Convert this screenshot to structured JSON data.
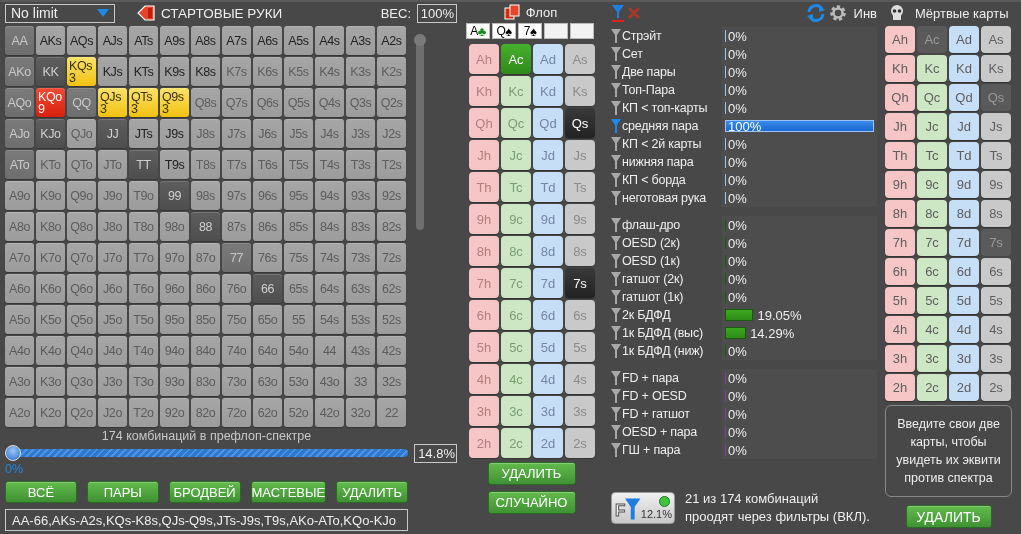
{
  "left_panel": {
    "game_select": {
      "value": "No limit"
    },
    "title": "СТАРТОВЫЕ РУКИ",
    "weight": {
      "label": "ВЕС:",
      "value": "100%"
    },
    "hand_grid": [
      [
        {
          "label": "AA",
          "kind": "blocked"
        },
        {
          "label": "AKs",
          "kind": "selected"
        },
        {
          "label": "AQs",
          "kind": "selected"
        },
        {
          "label": "AJs",
          "kind": "selected"
        },
        {
          "label": "ATs",
          "kind": "selected"
        },
        {
          "label": "A9s",
          "kind": "selected"
        },
        {
          "label": "A8s",
          "kind": "selected"
        },
        {
          "label": "A7s",
          "kind": "selected"
        },
        {
          "label": "A6s",
          "kind": "selected"
        },
        {
          "label": "A5s",
          "kind": "selected"
        },
        {
          "label": "A4s",
          "kind": "selected"
        },
        {
          "label": "A3s",
          "kind": "selected"
        },
        {
          "label": "A2s",
          "kind": "selected"
        }
      ],
      [
        {
          "label": "AKo",
          "kind": "blocked"
        },
        {
          "label": "KK",
          "kind": "dark"
        },
        {
          "label": "KQs",
          "kind": "hit",
          "count": "3"
        },
        {
          "label": "KJs",
          "kind": "selected"
        },
        {
          "label": "KTs",
          "kind": "selected"
        },
        {
          "label": "K9s",
          "kind": "selected"
        },
        {
          "label": "K8s",
          "kind": "selected"
        },
        {
          "label": "K7s",
          "kind": "off"
        },
        {
          "label": "K6s",
          "kind": "off"
        },
        {
          "label": "K5s",
          "kind": "off"
        },
        {
          "label": "K4s",
          "kind": "off"
        },
        {
          "label": "K3s",
          "kind": "off"
        },
        {
          "label": "K2s",
          "kind": "off"
        }
      ],
      [
        {
          "label": "AQo",
          "kind": "blocked"
        },
        {
          "label": "KQo",
          "kind": "hitmax",
          "count": "9"
        },
        {
          "label": "QQ",
          "kind": "blocked"
        },
        {
          "label": "QJs",
          "kind": "hit",
          "count": "3"
        },
        {
          "label": "QTs",
          "kind": "hit",
          "count": "3"
        },
        {
          "label": "Q9s",
          "kind": "hit",
          "count": "3"
        },
        {
          "label": "Q8s",
          "kind": "off"
        },
        {
          "label": "Q7s",
          "kind": "off"
        },
        {
          "label": "Q6s",
          "kind": "off"
        },
        {
          "label": "Q5s",
          "kind": "off"
        },
        {
          "label": "Q4s",
          "kind": "off"
        },
        {
          "label": "Q3s",
          "kind": "off"
        },
        {
          "label": "Q2s",
          "kind": "off"
        }
      ],
      [
        {
          "label": "AJo",
          "kind": "blocked"
        },
        {
          "label": "KJo",
          "kind": "dark"
        },
        {
          "label": "QJo",
          "kind": "off"
        },
        {
          "label": "JJ",
          "kind": "dark"
        },
        {
          "label": "JTs",
          "kind": "selected"
        },
        {
          "label": "J9s",
          "kind": "selected"
        },
        {
          "label": "J8s",
          "kind": "off"
        },
        {
          "label": "J7s",
          "kind": "off"
        },
        {
          "label": "J6s",
          "kind": "off"
        },
        {
          "label": "J5s",
          "kind": "off"
        },
        {
          "label": "J4s",
          "kind": "off"
        },
        {
          "label": "J3s",
          "kind": "off"
        },
        {
          "label": "J2s",
          "kind": "off"
        }
      ],
      [
        {
          "label": "ATo",
          "kind": "blocked"
        },
        {
          "label": "KTo",
          "kind": "off"
        },
        {
          "label": "QTo",
          "kind": "off"
        },
        {
          "label": "JTo",
          "kind": "off"
        },
        {
          "label": "TT",
          "kind": "dark"
        },
        {
          "label": "T9s",
          "kind": "selected"
        },
        {
          "label": "T8s",
          "kind": "off"
        },
        {
          "label": "T7s",
          "kind": "off"
        },
        {
          "label": "T6s",
          "kind": "off"
        },
        {
          "label": "T5s",
          "kind": "off"
        },
        {
          "label": "T4s",
          "kind": "off"
        },
        {
          "label": "T3s",
          "kind": "off"
        },
        {
          "label": "T2s",
          "kind": "off"
        }
      ],
      [
        {
          "label": "A9o",
          "kind": "off"
        },
        {
          "label": "K9o",
          "kind": "off"
        },
        {
          "label": "Q9o",
          "kind": "off"
        },
        {
          "label": "J9o",
          "kind": "off"
        },
        {
          "label": "T9o",
          "kind": "off"
        },
        {
          "label": "99",
          "kind": "dark"
        },
        {
          "label": "98s",
          "kind": "off"
        },
        {
          "label": "97s",
          "kind": "off"
        },
        {
          "label": "96s",
          "kind": "off"
        },
        {
          "label": "95s",
          "kind": "off"
        },
        {
          "label": "94s",
          "kind": "off"
        },
        {
          "label": "93s",
          "kind": "off"
        },
        {
          "label": "92s",
          "kind": "off"
        }
      ],
      [
        {
          "label": "A8o",
          "kind": "off"
        },
        {
          "label": "K8o",
          "kind": "off"
        },
        {
          "label": "Q8o",
          "kind": "off"
        },
        {
          "label": "J8o",
          "kind": "off"
        },
        {
          "label": "T8o",
          "kind": "off"
        },
        {
          "label": "98o",
          "kind": "off"
        },
        {
          "label": "88",
          "kind": "dark"
        },
        {
          "label": "87s",
          "kind": "off"
        },
        {
          "label": "86s",
          "kind": "off"
        },
        {
          "label": "85s",
          "kind": "off"
        },
        {
          "label": "84s",
          "kind": "off"
        },
        {
          "label": "83s",
          "kind": "off"
        },
        {
          "label": "82s",
          "kind": "off"
        }
      ],
      [
        {
          "label": "A7o",
          "kind": "off"
        },
        {
          "label": "K7o",
          "kind": "off"
        },
        {
          "label": "Q7o",
          "kind": "off"
        },
        {
          "label": "J7o",
          "kind": "off"
        },
        {
          "label": "T7o",
          "kind": "off"
        },
        {
          "label": "97o",
          "kind": "off"
        },
        {
          "label": "87o",
          "kind": "off"
        },
        {
          "label": "77",
          "kind": "blocked"
        },
        {
          "label": "76s",
          "kind": "off"
        },
        {
          "label": "75s",
          "kind": "off"
        },
        {
          "label": "74s",
          "kind": "off"
        },
        {
          "label": "73s",
          "kind": "off"
        },
        {
          "label": "72s",
          "kind": "off"
        }
      ],
      [
        {
          "label": "A6o",
          "kind": "off"
        },
        {
          "label": "K6o",
          "kind": "off"
        },
        {
          "label": "Q6o",
          "kind": "off"
        },
        {
          "label": "J6o",
          "kind": "off"
        },
        {
          "label": "T6o",
          "kind": "off"
        },
        {
          "label": "96o",
          "kind": "off"
        },
        {
          "label": "86o",
          "kind": "off"
        },
        {
          "label": "76o",
          "kind": "off"
        },
        {
          "label": "66",
          "kind": "dark"
        },
        {
          "label": "65s",
          "kind": "off"
        },
        {
          "label": "64s",
          "kind": "off"
        },
        {
          "label": "63s",
          "kind": "off"
        },
        {
          "label": "62s",
          "kind": "off"
        }
      ],
      [
        {
          "label": "A5o",
          "kind": "off"
        },
        {
          "label": "K5o",
          "kind": "off"
        },
        {
          "label": "Q5o",
          "kind": "off"
        },
        {
          "label": "J5o",
          "kind": "off"
        },
        {
          "label": "T5o",
          "kind": "off"
        },
        {
          "label": "95o",
          "kind": "off"
        },
        {
          "label": "85o",
          "kind": "off"
        },
        {
          "label": "75o",
          "kind": "off"
        },
        {
          "label": "65o",
          "kind": "off"
        },
        {
          "label": "55",
          "kind": "off"
        },
        {
          "label": "54s",
          "kind": "off"
        },
        {
          "label": "53s",
          "kind": "off"
        },
        {
          "label": "52s",
          "kind": "off"
        }
      ],
      [
        {
          "label": "A4o",
          "kind": "off"
        },
        {
          "label": "K4o",
          "kind": "off"
        },
        {
          "label": "Q4o",
          "kind": "off"
        },
        {
          "label": "J4o",
          "kind": "off"
        },
        {
          "label": "T4o",
          "kind": "off"
        },
        {
          "label": "94o",
          "kind": "off"
        },
        {
          "label": "84o",
          "kind": "off"
        },
        {
          "label": "74o",
          "kind": "off"
        },
        {
          "label": "64o",
          "kind": "off"
        },
        {
          "label": "54o",
          "kind": "off"
        },
        {
          "label": "44",
          "kind": "off"
        },
        {
          "label": "43s",
          "kind": "off"
        },
        {
          "label": "42s",
          "kind": "off"
        }
      ],
      [
        {
          "label": "A3o",
          "kind": "off"
        },
        {
          "label": "K3o",
          "kind": "off"
        },
        {
          "label": "Q3o",
          "kind": "off"
        },
        {
          "label": "J3o",
          "kind": "off"
        },
        {
          "label": "T3o",
          "kind": "off"
        },
        {
          "label": "93o",
          "kind": "off"
        },
        {
          "label": "83o",
          "kind": "off"
        },
        {
          "label": "73o",
          "kind": "off"
        },
        {
          "label": "63o",
          "kind": "off"
        },
        {
          "label": "53o",
          "kind": "off"
        },
        {
          "label": "43o",
          "kind": "off"
        },
        {
          "label": "33",
          "kind": "off"
        },
        {
          "label": "32s",
          "kind": "off"
        }
      ],
      [
        {
          "label": "A2o",
          "kind": "off"
        },
        {
          "label": "K2o",
          "kind": "off"
        },
        {
          "label": "Q2o",
          "kind": "off"
        },
        {
          "label": "J2o",
          "kind": "off"
        },
        {
          "label": "T2o",
          "kind": "off"
        },
        {
          "label": "92o",
          "kind": "off"
        },
        {
          "label": "82o",
          "kind": "off"
        },
        {
          "label": "72o",
          "kind": "off"
        },
        {
          "label": "62o",
          "kind": "off"
        },
        {
          "label": "52o",
          "kind": "off"
        },
        {
          "label": "42o",
          "kind": "off"
        },
        {
          "label": "32o",
          "kind": "off"
        },
        {
          "label": "22",
          "kind": "off"
        }
      ]
    ],
    "combo_count": "174 комбинаций в префлоп-спектре",
    "range_slider": {
      "level": 0,
      "min_label": "0%",
      "value": "14.8%"
    },
    "buttons": [
      "ВСЁ",
      "ПАРЫ",
      "БРОДВЕЙ",
      "МАСТЕВЫЕ",
      "УДАЛИТЬ"
    ],
    "range_text": "AA-66,AKs-A2s,KQs-K8s,QJs-Q9s,JTs-J9s,T9s,AKo-ATo,KQo-KJo"
  },
  "flop": {
    "title": "Флоп",
    "board": [
      {
        "kind": "card",
        "rank": "A",
        "suit": "♣",
        "color": "#178a17"
      },
      {
        "kind": "card",
        "rank": "Q",
        "suit": "♠",
        "color": "#000000"
      },
      {
        "kind": "card",
        "rank": "7",
        "suit": "♠",
        "color": "#000000"
      },
      {
        "kind": "empty"
      },
      {
        "kind": "empty"
      }
    ],
    "cards": [
      [
        {
          "label": "Ah",
          "kind": "free"
        },
        {
          "label": "Ac",
          "kind": "picked"
        },
        {
          "label": "Ad",
          "kind": "free"
        },
        {
          "label": "As",
          "kind": "free"
        }
      ],
      [
        {
          "label": "Kh",
          "kind": "free"
        },
        {
          "label": "Kc",
          "kind": "free"
        },
        {
          "label": "Kd",
          "kind": "free"
        },
        {
          "label": "Ks",
          "kind": "free"
        }
      ],
      [
        {
          "label": "Qh",
          "kind": "free"
        },
        {
          "label": "Qc",
          "kind": "free"
        },
        {
          "label": "Qd",
          "kind": "free"
        },
        {
          "label": "Qs",
          "kind": "picked"
        }
      ],
      [
        {
          "label": "Jh",
          "kind": "free"
        },
        {
          "label": "Jc",
          "kind": "free"
        },
        {
          "label": "Jd",
          "kind": "free"
        },
        {
          "label": "Js",
          "kind": "free"
        }
      ],
      [
        {
          "label": "Th",
          "kind": "free"
        },
        {
          "label": "Tc",
          "kind": "free"
        },
        {
          "label": "Td",
          "kind": "free"
        },
        {
          "label": "Ts",
          "kind": "free"
        }
      ],
      [
        {
          "label": "9h",
          "kind": "free"
        },
        {
          "label": "9c",
          "kind": "free"
        },
        {
          "label": "9d",
          "kind": "free"
        },
        {
          "label": "9s",
          "kind": "free"
        }
      ],
      [
        {
          "label": "8h",
          "kind": "free"
        },
        {
          "label": "8c",
          "kind": "free"
        },
        {
          "label": "8d",
          "kind": "free"
        },
        {
          "label": "8s",
          "kind": "free"
        }
      ],
      [
        {
          "label": "7h",
          "kind": "free"
        },
        {
          "label": "7c",
          "kind": "free"
        },
        {
          "label": "7d",
          "kind": "free"
        },
        {
          "label": "7s",
          "kind": "picked"
        }
      ],
      [
        {
          "label": "6h",
          "kind": "free"
        },
        {
          "label": "6c",
          "kind": "free"
        },
        {
          "label": "6d",
          "kind": "free"
        },
        {
          "label": "6s",
          "kind": "free"
        }
      ],
      [
        {
          "label": "5h",
          "kind": "free"
        },
        {
          "label": "5c",
          "kind": "free"
        },
        {
          "label": "5d",
          "kind": "free"
        },
        {
          "label": "5s",
          "kind": "free"
        }
      ],
      [
        {
          "label": "4h",
          "kind": "free"
        },
        {
          "label": "4c",
          "kind": "free"
        },
        {
          "label": "4d",
          "kind": "free"
        },
        {
          "label": "4s",
          "kind": "free"
        }
      ],
      [
        {
          "label": "3h",
          "kind": "free"
        },
        {
          "label": "3c",
          "kind": "free"
        },
        {
          "label": "3d",
          "kind": "free"
        },
        {
          "label": "3s",
          "kind": "free"
        }
      ],
      [
        {
          "label": "2h",
          "kind": "free"
        },
        {
          "label": "2c",
          "kind": "free"
        },
        {
          "label": "2d",
          "kind": "free"
        },
        {
          "label": "2s",
          "kind": "free"
        }
      ]
    ],
    "buttons": [
      "УДАЛИТЬ",
      "СЛУЧАЙНО"
    ]
  },
  "filters": {
    "groups": [
      {
        "kind": "made",
        "rows": [
          {
            "label": "Стрэйт",
            "value": "0%",
            "level": 0,
            "active": false
          },
          {
            "label": "Сет",
            "value": "0%",
            "level": 0,
            "active": false
          },
          {
            "label": "Две пары",
            "value": "0%",
            "level": 0,
            "active": false
          },
          {
            "label": "Топ-Пара",
            "value": "0%",
            "level": 0,
            "active": false
          },
          {
            "label": "КП < топ-карты",
            "value": "0%",
            "level": 0,
            "active": false
          },
          {
            "label": "средняя пара",
            "value": "100%",
            "level": 1,
            "active": true
          },
          {
            "label": "КП < 2й карты",
            "value": "0%",
            "level": 0,
            "active": false
          },
          {
            "label": "нижняя пара",
            "value": "0%",
            "level": 0,
            "active": false
          },
          {
            "label": "КП < борда",
            "value": "0%",
            "level": 0,
            "active": false
          },
          {
            "label": "неготовая рука",
            "value": "0%",
            "level": 0,
            "active": false
          }
        ]
      },
      {
        "kind": "draw",
        "rows": [
          {
            "label": "флаш-дро",
            "value": "0%",
            "level": 0,
            "active": false
          },
          {
            "label": "OESD (2к)",
            "value": "0%",
            "level": 0,
            "active": false
          },
          {
            "label": "OESD (1к)",
            "value": "0%",
            "level": 0,
            "active": false
          },
          {
            "label": "гатшот (2к)",
            "value": "0%",
            "level": 0,
            "active": false
          },
          {
            "label": "гатшот (1к)",
            "value": "0%",
            "level": 0,
            "active": false
          },
          {
            "label": "2к БДФД",
            "value": "19.05%",
            "level": 0.1905,
            "active": false
          },
          {
            "label": "1к БДФД (выс)",
            "value": "14.29%",
            "level": 0.1429,
            "active": false
          },
          {
            "label": "1к БДФД (ниж)",
            "value": "0%",
            "level": 0,
            "active": false
          }
        ]
      },
      {
        "kind": "combo",
        "rows": [
          {
            "label": "FD + пара",
            "value": "0%",
            "level": 0,
            "active": false
          },
          {
            "label": "FD + OESD",
            "value": "0%",
            "level": 0,
            "active": false
          },
          {
            "label": "FD + гатшот",
            "value": "0%",
            "level": 0,
            "active": false
          },
          {
            "label": "OESD + пара",
            "value": "0%",
            "level": 0,
            "active": false
          },
          {
            "label": "ГШ + пара",
            "value": "0%",
            "level": 0,
            "active": false
          }
        ]
      }
    ],
    "inv_label": "Инв",
    "filter_switch": {
      "letter": "F",
      "value": "12.1%",
      "on": true
    },
    "summary": [
      "21 из 174 комбинаций",
      "проодят через фильтры (ВКЛ)."
    ]
  },
  "dead_cards": {
    "title": "Мёртвые карты",
    "cards": [
      [
        {
          "label": "Ah",
          "kind": "free"
        },
        {
          "label": "Ac",
          "kind": "blocked"
        },
        {
          "label": "Ad",
          "kind": "free"
        },
        {
          "label": "As",
          "kind": "free"
        }
      ],
      [
        {
          "label": "Kh",
          "kind": "free"
        },
        {
          "label": "Kc",
          "kind": "free"
        },
        {
          "label": "Kd",
          "kind": "free"
        },
        {
          "label": "Ks",
          "kind": "free"
        }
      ],
      [
        {
          "label": "Qh",
          "kind": "free"
        },
        {
          "label": "Qc",
          "kind": "free"
        },
        {
          "label": "Qd",
          "kind": "free"
        },
        {
          "label": "Qs",
          "kind": "blocked"
        }
      ],
      [
        {
          "label": "Jh",
          "kind": "free"
        },
        {
          "label": "Jc",
          "kind": "free"
        },
        {
          "label": "Jd",
          "kind": "free"
        },
        {
          "label": "Js",
          "kind": "free"
        }
      ],
      [
        {
          "label": "Th",
          "kind": "free"
        },
        {
          "label": "Tc",
          "kind": "free"
        },
        {
          "label": "Td",
          "kind": "free"
        },
        {
          "label": "Ts",
          "kind": "free"
        }
      ],
      [
        {
          "label": "9h",
          "kind": "free"
        },
        {
          "label": "9c",
          "kind": "free"
        },
        {
          "label": "9d",
          "kind": "free"
        },
        {
          "label": "9s",
          "kind": "free"
        }
      ],
      [
        {
          "label": "8h",
          "kind": "free"
        },
        {
          "label": "8c",
          "kind": "free"
        },
        {
          "label": "8d",
          "kind": "free"
        },
        {
          "label": "8s",
          "kind": "free"
        }
      ],
      [
        {
          "label": "7h",
          "kind": "free"
        },
        {
          "label": "7c",
          "kind": "free"
        },
        {
          "label": "7d",
          "kind": "free"
        },
        {
          "label": "7s",
          "kind": "blocked"
        }
      ],
      [
        {
          "label": "6h",
          "kind": "free"
        },
        {
          "label": "6c",
          "kind": "free"
        },
        {
          "label": "6d",
          "kind": "free"
        },
        {
          "label": "6s",
          "kind": "free"
        }
      ],
      [
        {
          "label": "5h",
          "kind": "free"
        },
        {
          "label": "5c",
          "kind": "free"
        },
        {
          "label": "5d",
          "kind": "free"
        },
        {
          "label": "5s",
          "kind": "free"
        }
      ],
      [
        {
          "label": "4h",
          "kind": "free"
        },
        {
          "label": "4c",
          "kind": "free"
        },
        {
          "label": "4d",
          "kind": "free"
        },
        {
          "label": "4s",
          "kind": "free"
        }
      ],
      [
        {
          "label": "3h",
          "kind": "free"
        },
        {
          "label": "3c",
          "kind": "free"
        },
        {
          "label": "3d",
          "kind": "free"
        },
        {
          "label": "3s",
          "kind": "free"
        }
      ],
      [
        {
          "label": "2h",
          "kind": "free"
        },
        {
          "label": "2c",
          "kind": "free"
        },
        {
          "label": "2d",
          "kind": "free"
        },
        {
          "label": "2s",
          "kind": "free"
        }
      ]
    ],
    "message": "Введите свои две карты, чтобы увидеть их эквити против спектра",
    "button": "УДАЛИТЬ"
  }
}
